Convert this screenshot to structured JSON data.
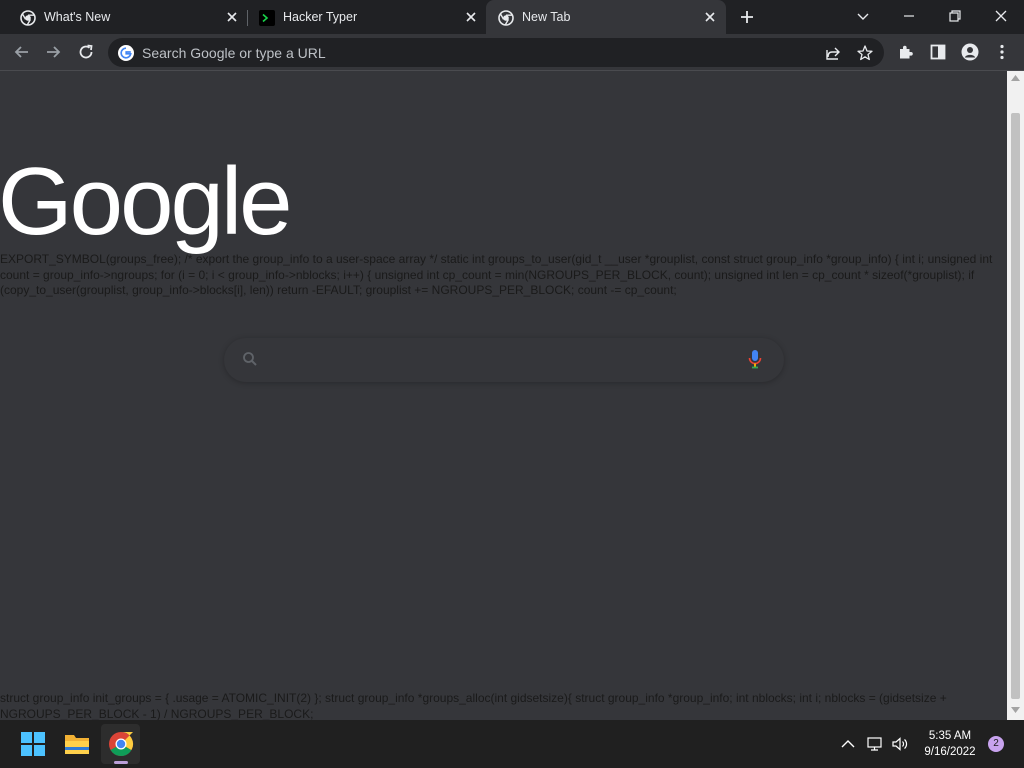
{
  "tabs": [
    {
      "title": "What's New",
      "icon": "chrome-icon"
    },
    {
      "title": "Hacker Typer",
      "icon": "terminal-icon"
    },
    {
      "title": "New Tab",
      "icon": "chrome-icon",
      "active": true
    }
  ],
  "omnibox": {
    "placeholder": "Search Google or type a URL"
  },
  "page": {
    "logo": "Google",
    "code_top": "EXPORT_SYMBOL(groups_free); /* export the group_info to a user-space array */ static int groups_to_user(gid_t __user *grouplist, const struct group_info *group_info) { int i; unsigned int count = group_info->ngroups; for (i = 0; i < group_info->nblocks; i++) { unsigned int cp_count = min(NGROUPS_PER_BLOCK, count); unsigned int len = cp_count * sizeof(*grouplist); if (copy_to_user(grouplist, group_info->blocks[i], len)) return -EFAULT; grouplist += NGROUPS_PER_BLOCK; count -= cp_count;",
    "code_bottom": "struct group_info init_groups = { .usage = ATOMIC_INIT(2) }; struct group_info *groups_alloc(int gidsetsize){ struct group_info *group_info; int nblocks; int i; nblocks = (gidsetsize + NGROUPS_PER_BLOCK - 1) / NGROUPS_PER_BLOCK;"
  },
  "taskbar": {
    "time": "5:35 AM",
    "date": "9/16/2022",
    "notification_count": "2"
  },
  "colors": {
    "tab_bg": "#202124",
    "toolbar_bg": "#35363a",
    "content_bg": "#35363a",
    "taskbar_bg": "#202020",
    "accent": "#c8a3ee"
  }
}
